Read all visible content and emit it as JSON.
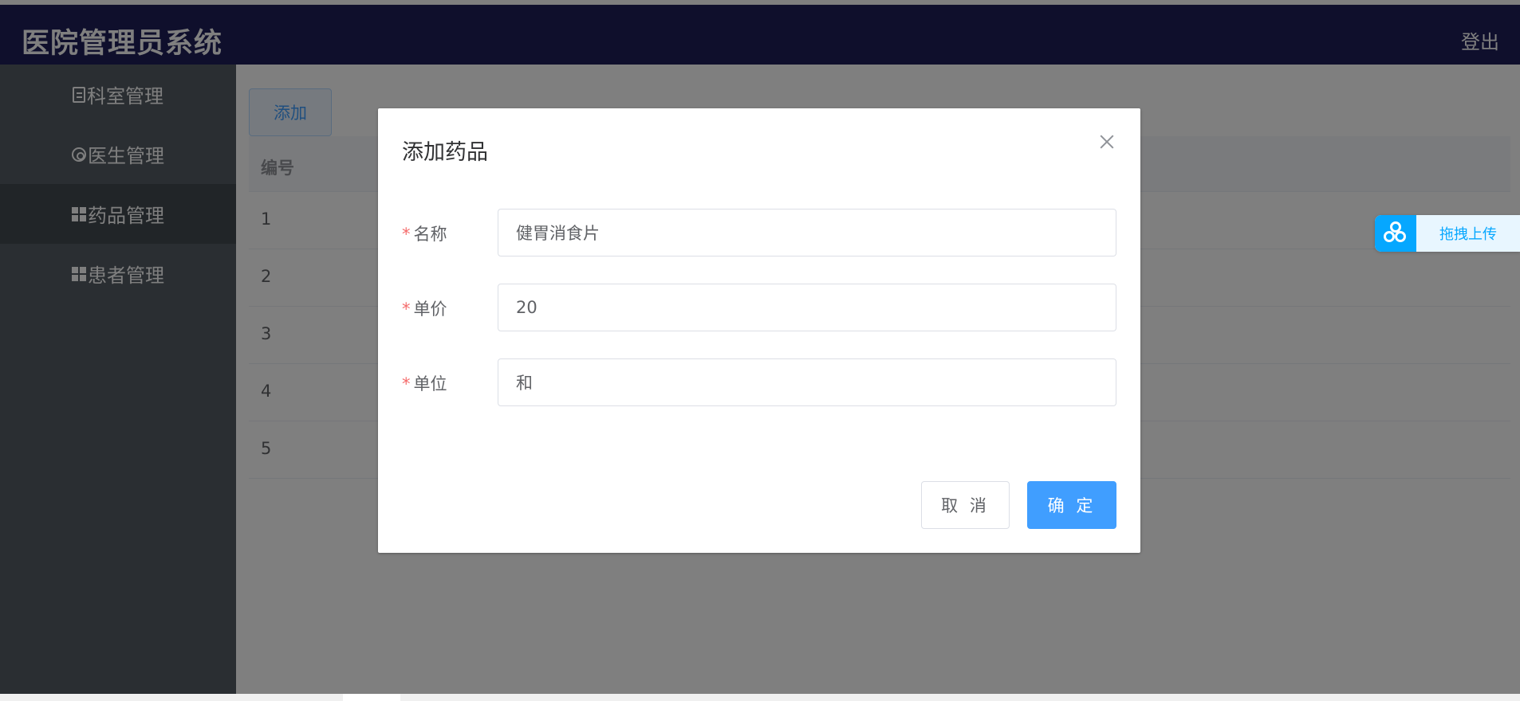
{
  "header": {
    "title": "医院管理员系统",
    "logout_label": "登出"
  },
  "sidebar": {
    "items": [
      {
        "label": "科室管理",
        "icon": "document-icon"
      },
      {
        "label": "医生管理",
        "icon": "gear-icon"
      },
      {
        "label": "药品管理",
        "icon": "grid-icon",
        "active": true
      },
      {
        "label": "患者管理",
        "icon": "grid-icon"
      }
    ]
  },
  "main": {
    "add_label": "添加",
    "table": {
      "header": "编号",
      "rows": [
        "1",
        "2",
        "3",
        "4",
        "5"
      ]
    }
  },
  "dialog": {
    "title": "添加药品",
    "fields": [
      {
        "label": "名称",
        "value": "健胃消食片",
        "required": true
      },
      {
        "label": "单价",
        "value": "20",
        "required": true
      },
      {
        "label": "单位",
        "value": "和",
        "required": true
      }
    ],
    "cancel_label": "取 消",
    "confirm_label": "确 定"
  },
  "upload_widget": {
    "label": "拖拽上传",
    "icon": "cloud-icon"
  },
  "colors": {
    "header_bg": "#1e1e58",
    "sidebar_bg": "#545c64",
    "sidebar_active": "#434a50",
    "primary": "#409eff",
    "required": "#f56c6c"
  }
}
